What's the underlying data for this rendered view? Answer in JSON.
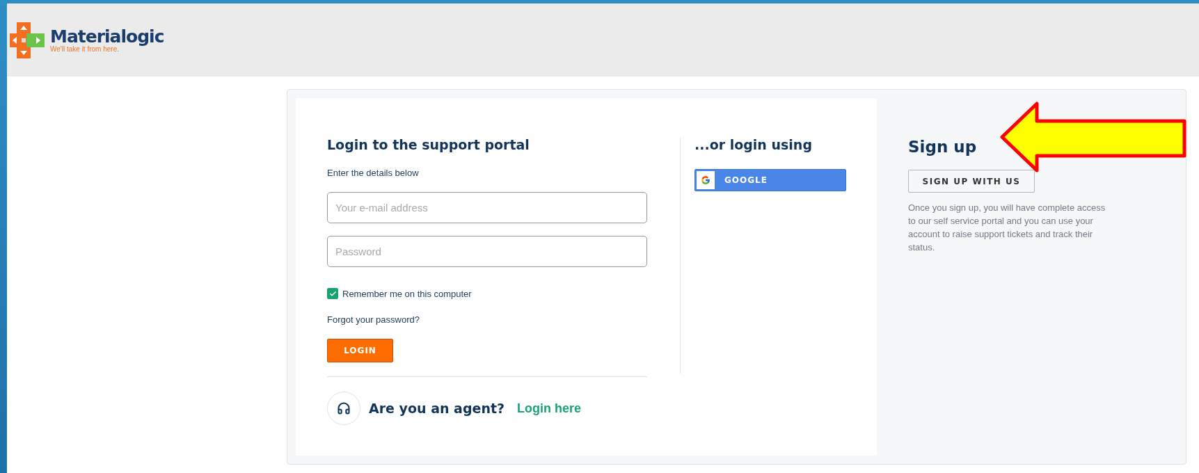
{
  "logo": {
    "name": "Materialogic",
    "tagline": "We'll take it from here."
  },
  "login": {
    "title": "Login to the support portal",
    "subtitle": "Enter the details below",
    "email": {
      "placeholder": "Your e-mail address"
    },
    "password": {
      "placeholder": "Password"
    },
    "remember": {
      "label": "Remember me on this computer",
      "checked": true
    },
    "forgot": "Forgot your password?",
    "button": "LOGIN",
    "agent": {
      "question": "Are you an agent?",
      "link": "Login here"
    }
  },
  "social": {
    "title": "...or login using",
    "buttons": [
      {
        "kind": "google",
        "label": "GOOGLE"
      }
    ]
  },
  "signup": {
    "title": "Sign up",
    "button": "SIGN UP WITH US",
    "text": "Once you sign up, you will have complete access to our self service portal and you can use your account to raise support tickets and track their status."
  }
}
